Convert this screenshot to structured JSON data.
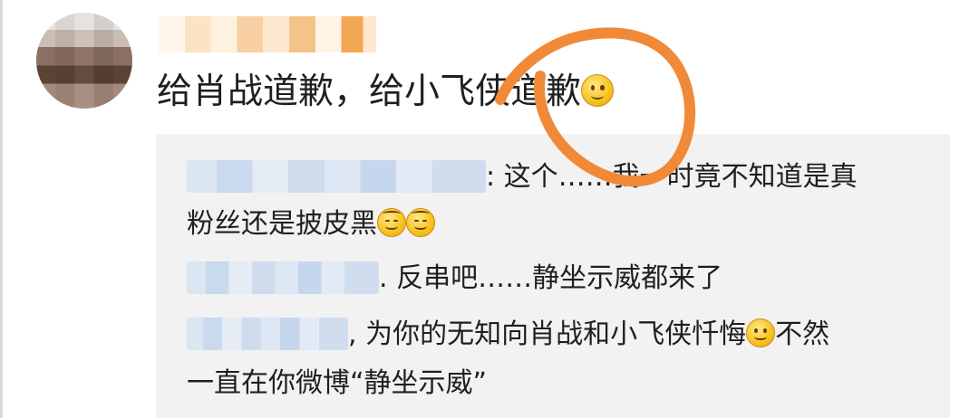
{
  "post": {
    "avatar_icon": "blurred-avatar",
    "username_blurred": true,
    "text": "给肖战道歉，给小飞侠道歉",
    "emoji": "smile-emoji"
  },
  "replies": [
    {
      "user_blurred": true,
      "line1": ": 这个……我一时竟不知道是真",
      "line2": "粉丝还是披皮黑",
      "emojis": [
        "sweat-smile-emoji",
        "sweat-smile-emoji"
      ]
    },
    {
      "user_blurred": true,
      "line1": ". 反串吧……静坐示威都来了"
    },
    {
      "user_blurred": true,
      "line1": ", 为你的无知向肖战和小飞侠忏悔",
      "emoji": "smile-emoji",
      "line1_tail": "不然",
      "line2": "一直在你微博“静坐示威”"
    }
  ],
  "annotation": {
    "type": "hand-drawn circle",
    "color": "#f08a38"
  }
}
